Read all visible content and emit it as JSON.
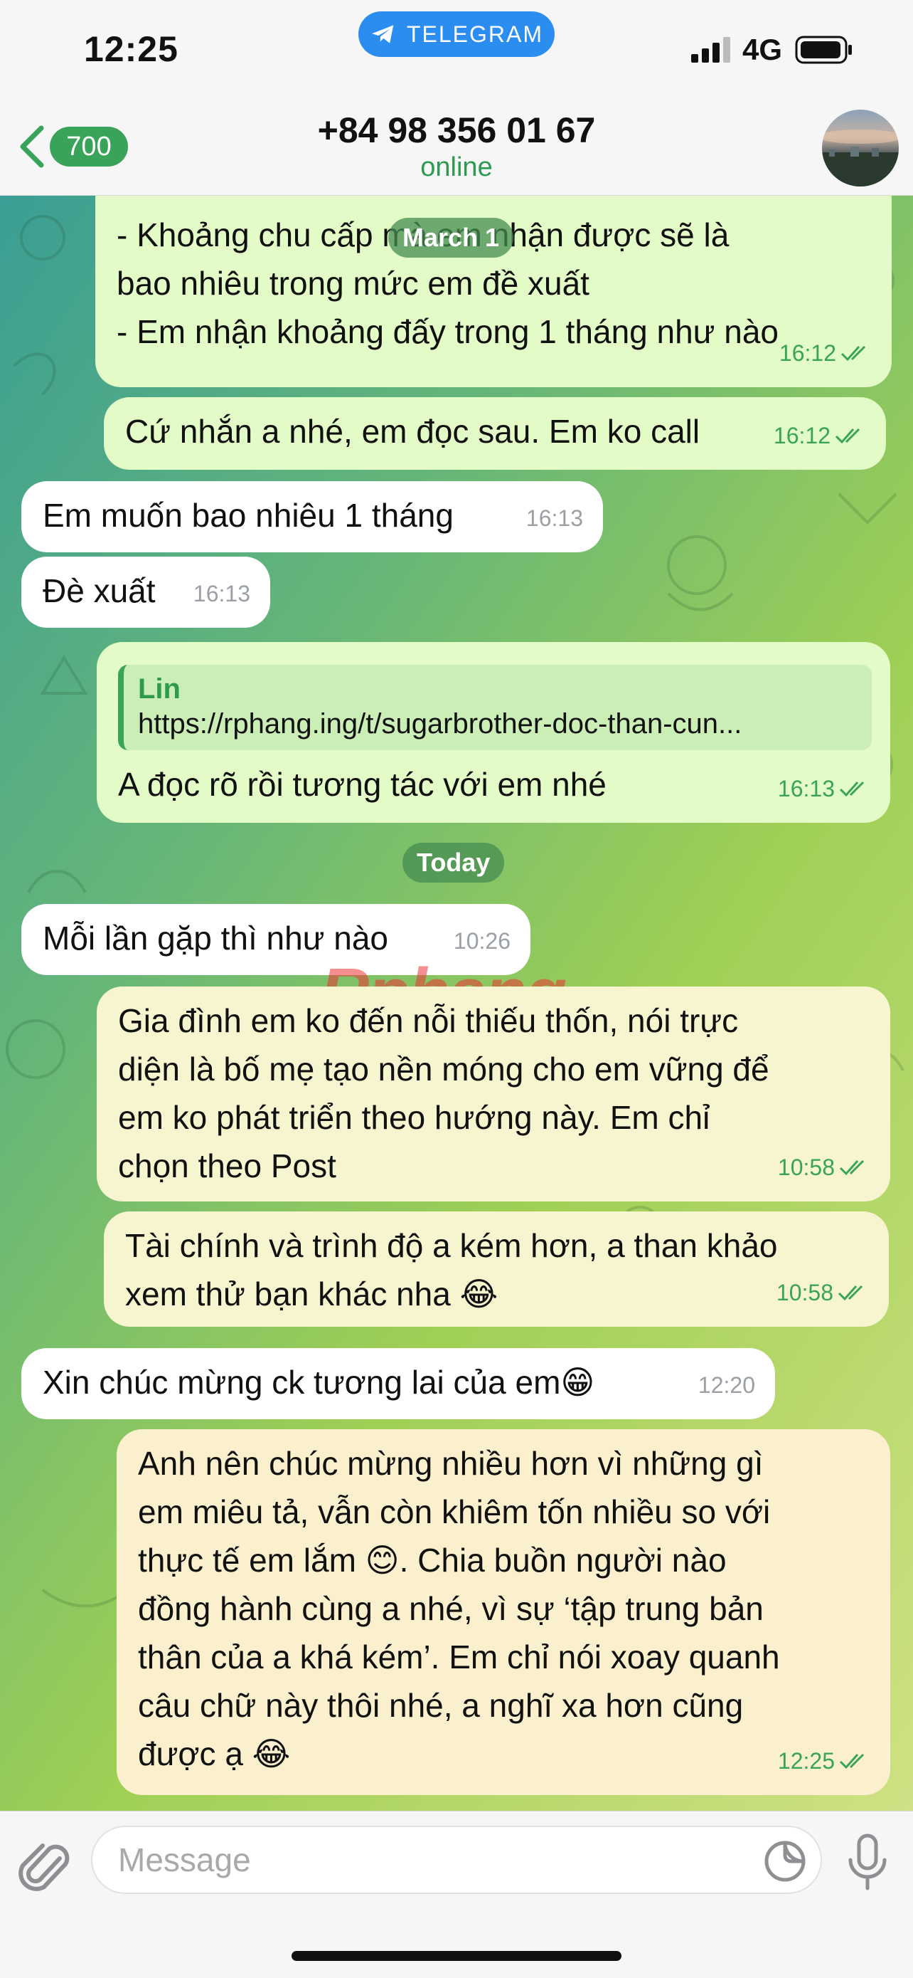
{
  "status_bar": {
    "time": "12:25",
    "app_pill": "TELEGRAM",
    "network": "4G"
  },
  "header": {
    "back_count": "700",
    "title": "+84 98 356 01 67",
    "status": "online"
  },
  "messages": [
    {
      "dir": "out",
      "lines": [
        "- Khoảng chu cấp mà em nhận được sẽ là",
        "bao nhiêu trong mức em đề xuất",
        "- Em nhận khoảng đấy trong 1 tháng như nào"
      ],
      "time": "16:12"
    },
    {
      "dir": "out",
      "lines": [
        "Cứ nhắn a nhé, em đọc sau. Em ko call"
      ],
      "time": "16:12"
    },
    {
      "dir": "in",
      "lines": [
        "Em muốn bao nhiêu 1 tháng"
      ],
      "time": "16:13"
    },
    {
      "dir": "in",
      "lines": [
        "Đè xuất"
      ],
      "time": "16:13"
    },
    {
      "dir": "out",
      "reply_name": "Lin",
      "reply_text": "https://rphang.ing/t/sugarbrother-doc-than-cun...",
      "lines": [
        "A đọc rõ rồi tương tác với em nhé"
      ],
      "time": "16:13"
    },
    {
      "dir": "in",
      "lines": [
        "Mỗi lần gặp thì như nào"
      ],
      "time": "10:26"
    },
    {
      "dir": "out",
      "lines": [
        "Gia đình em ko đến nỗi thiếu thốn, nói trực",
        "diện là bố mẹ tạo nền móng cho em vững để",
        "em ko phát triển theo hướng này. Em chỉ",
        "chọn theo Post"
      ],
      "time": "10:58"
    },
    {
      "dir": "out",
      "lines": [
        "Tài chính và trình độ a kém hơn, a than khảo",
        "xem thử bạn khác nha 😂"
      ],
      "time": "10:58"
    },
    {
      "dir": "in",
      "lines": [
        "Xin chúc mừng ck tương lai của em😁"
      ],
      "time": "12:20"
    },
    {
      "dir": "out",
      "lines": [
        "Anh nên chúc mừng nhiều hơn vì những gì",
        "em miêu tả, vẫn còn khiêm tốn nhiều so với",
        "thực tế em lắm 😊. Chia buồn người nào",
        "đồng hành cùng a nhé, vì sự ‘tập trung bản",
        "thân của a khá kém’. Em chỉ nói xoay quanh",
        "câu chữ này thôi nhé, a nghĩ xa hơn cũng",
        "được ạ 😂"
      ],
      "time": "12:25"
    }
  ],
  "date_pills": {
    "first": "March 1",
    "second": "Today"
  },
  "watermark": {
    "part1": "Rphang",
    "part2": ""
  },
  "composer": {
    "placeholder": "Message"
  },
  "colors": {
    "accent": "#3aa35a",
    "telegram_blue": "#2c8df0",
    "bubble_out": "#e3fbc6",
    "bubble_in": "#ffffff"
  }
}
